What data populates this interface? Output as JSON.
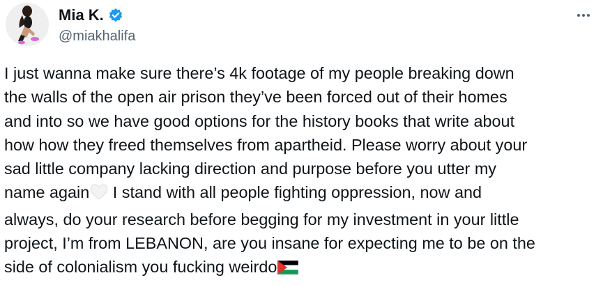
{
  "author": {
    "name": "Mia K.",
    "handle": "@miakhalifa",
    "verified": true,
    "verified_color": "#1d9bf0"
  },
  "menu": {
    "icon": "more-horizontal-icon"
  },
  "tweet": {
    "part1": "I just wanna make sure there’s 4k footage of my people breaking down\nthe walls of the open air prison they’ve been forced out of their homes\nand into so we have good options for the history books that write about\nhow how they freed themselves from apartheid. Please worry about your\nsad little company lacking direction and purpose before you utter my\nname again",
    "emoji_heart": "white-heart-emoji",
    "part2": " I stand with all people fighting oppression, now and\nalways, do your research before begging for my investment in your little\nproject, I’m from LEBANON, are you insane for expecting me to be on the\nside of colonialism you fucking weirdo",
    "emoji_flag": "palestine-flag-emoji"
  },
  "colors": {
    "text": "#0f1419",
    "secondary": "#536471",
    "flag_black": "#000000",
    "flag_white": "#ffffff",
    "flag_green": "#149954",
    "flag_red": "#e4312b"
  }
}
